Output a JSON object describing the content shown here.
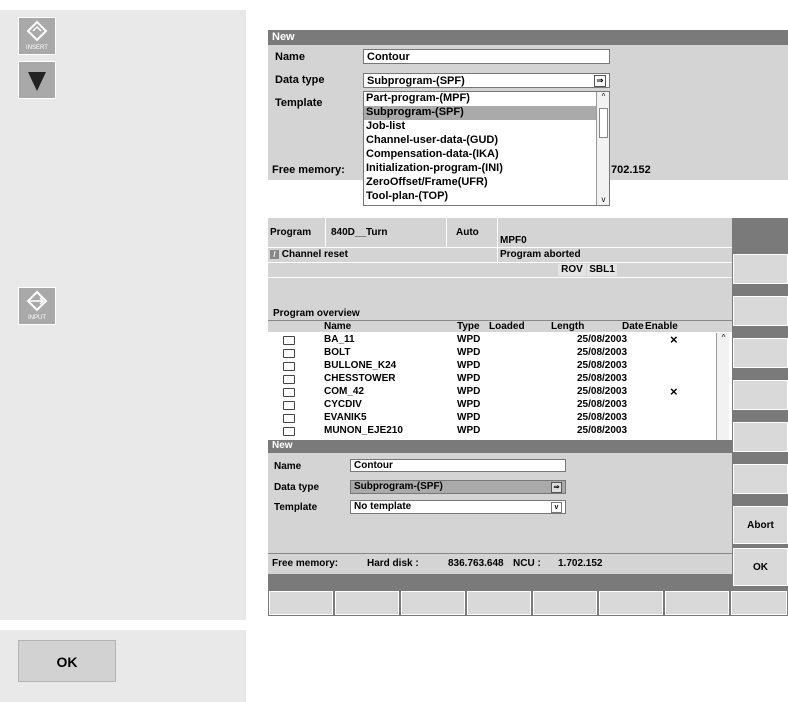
{
  "left_panel": {
    "insert_label": "INSERT",
    "input_label": "INPUT",
    "ok_label": "OK"
  },
  "dialog_top": {
    "title": "New",
    "name_label": "Name",
    "name_value": "Contour",
    "datatype_label": "Data type",
    "datatype_value": "Subprogram-(SPF)",
    "template_label": "Template",
    "options": [
      "Part-program-(MPF)",
      "Subprogram-(SPF)",
      "Job-list",
      "Channel-user-data-(GUD)",
      "Compensation-data-(IKA)",
      "Initialization-program-(INI)",
      "ZeroOffset/Frame(UFR)",
      "Tool-plan-(TOP)"
    ],
    "selected_option": "Subprogram-(SPF)",
    "free_memory_label": "Free memory:",
    "free_memory_value": "702.152"
  },
  "screen": {
    "status": {
      "program_label": "Program",
      "system": "840D__Turn",
      "mode": "Auto",
      "program_name": "MPF0",
      "channel": "Channel reset",
      "program_state": "Program aborted",
      "rov": "ROV",
      "sbl": "SBL1"
    },
    "overview": {
      "title": "Program overview",
      "columns": {
        "name": "Name",
        "type": "Type",
        "loaded": "Loaded",
        "length": "Length",
        "date": "Date",
        "enable": "Enable"
      },
      "rows": [
        {
          "name": "BA_11",
          "type": "WPD",
          "date": "25/08/2003",
          "enable": "×"
        },
        {
          "name": "BOLT",
          "type": "WPD",
          "date": "25/08/2003",
          "enable": ""
        },
        {
          "name": "BULLONE_K24",
          "type": "WPD",
          "date": "25/08/2003",
          "enable": ""
        },
        {
          "name": "CHESSTOWER",
          "type": "WPD",
          "date": "25/08/2003",
          "enable": ""
        },
        {
          "name": "COM_42",
          "type": "WPD",
          "date": "25/08/2003",
          "enable": "×"
        },
        {
          "name": "CYCDIV",
          "type": "WPD",
          "date": "25/08/2003",
          "enable": ""
        },
        {
          "name": "EVANIK5",
          "type": "WPD",
          "date": "25/08/2003",
          "enable": ""
        },
        {
          "name": "MUNON_EJE210",
          "type": "WPD",
          "date": "25/08/2003",
          "enable": ""
        }
      ]
    },
    "dialog": {
      "title": "New",
      "name_label": "Name",
      "name_value": "Contour",
      "datatype_label": "Data type",
      "datatype_value": "Subprogram-(SPF)",
      "template_label": "Template",
      "template_value": "No template",
      "free_memory_label": "Free memory:",
      "hard_disk_label": "Hard disk :",
      "hard_disk_value": "836.763.648",
      "ncu_label": "NCU :",
      "ncu_value": "1.702.152"
    },
    "softkeys": {
      "abort": "Abort",
      "ok": "OK"
    }
  },
  "colors": {
    "header": "#7a7a7a",
    "panel": "#e9e9e9",
    "selected": "#aaaaaa",
    "softkey": "#d9d9d9"
  }
}
